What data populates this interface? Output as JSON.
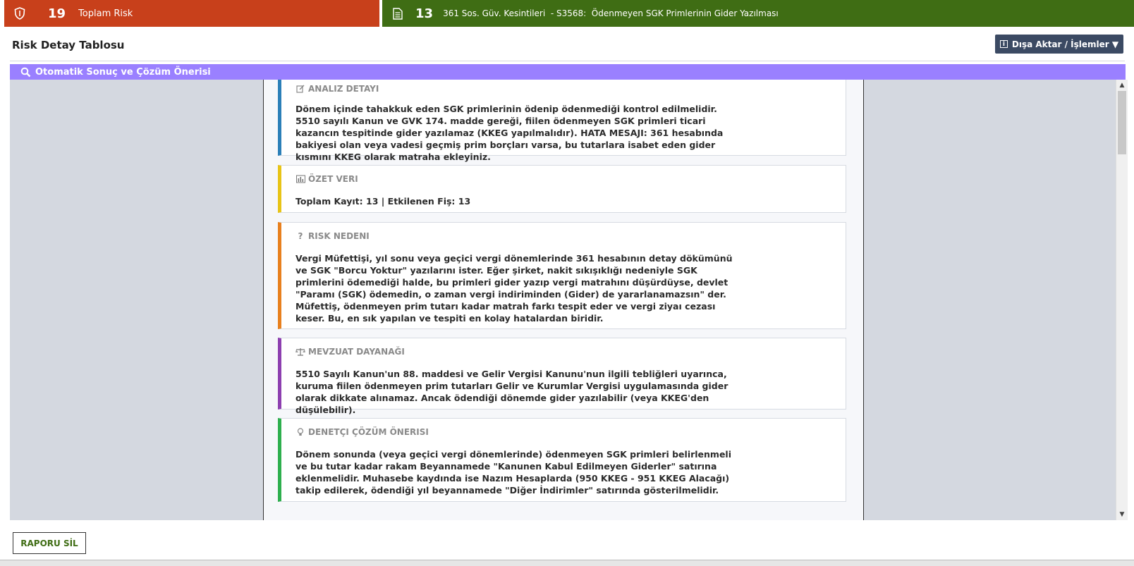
{
  "top": {
    "risk_count": "19",
    "risk_label": "Toplam Risk",
    "item_count": "13",
    "item_label": "361 Sos. Güv. Kesintileri  - S3568:  Ödenmeyen SGK Primlerinin Gider Yazılması"
  },
  "header": {
    "title": "Risk Detay Tablosu",
    "export_label": "Dışa Aktar / İşlemler ▼"
  },
  "section": {
    "title": "Otomatik Sonuç ve Çözüm Önerisi"
  },
  "cards": [
    {
      "title": "ANALIZ DETAYI",
      "icon": "note-icon",
      "color": "#2b7fb8",
      "text": "Dönem içinde tahakkuk eden SGK primlerinin ödenip ödenmediği kontrol edilmelidir. 5510 sayılı Kanun ve GVK 174. madde gereği, fiilen ödenmeyen SGK primleri ticari kazancın tespitinde gider yazılamaz (KKEG yapılmalıdır). HATA MESAJI: 361 hesabında bakiyesi olan veya vadesi geçmiş prim borçları varsa, bu tutarlara isabet eden gider kısmını KKEG olarak matraha ekleyiniz."
    },
    {
      "title": "ÖZET VERI",
      "icon": "chart-icon",
      "color": "#e8c417",
      "text": "Toplam Kayıt: 13 | Etkilenen Fiş: 13"
    },
    {
      "title": "RISK NEDENI",
      "icon": "question-icon",
      "color": "#e8801e",
      "text": "Vergi Müfettişi, yıl sonu veya geçici vergi dönemlerinde 361 hesabının detay dökümünü ve SGK \"Borcu Yoktur\" yazılarını ister. Eğer şirket, nakit sıkışıklığı nedeniyle SGK primlerini ödemediği halde, bu primleri gider yazıp vergi matrahını düşürdüyse, devlet \"Paramı (SGK) ödemedin, o zaman vergi indiriminden (Gider) de yararlanamazsın\" der. Müfettiş, ödenmeyen prim tutarı kadar matrah farkı tespit eder ve vergi ziyaı cezası keser. Bu, en sık yapılan ve tespiti en kolay hatalardan biridir."
    },
    {
      "title": "MEVZUAT DAYANAĞI",
      "icon": "scale-icon",
      "color": "#8d3fb0",
      "text": "5510 Sayılı Kanun'un 88. maddesi ve Gelir Vergisi Kanunu'nun ilgili tebliğleri uyarınca, kuruma fiilen ödenmeyen prim tutarları Gelir ve Kurumlar Vergisi uygulamasında gider olarak dikkate alınamaz. Ancak ödendiği dönemde gider yazılabilir (veya KKEG'den düşülebilir)."
    },
    {
      "title": "DENETÇI ÇÖZÜM ÖNERISI",
      "icon": "lightbulb-icon",
      "color": "#2eaf4e",
      "text": "Dönem sonunda (veya geçici vergi dönemlerinde) ödenmeyen SGK primleri belirlenmeli ve bu tutar kadar rakam Beyannamede \"Kanunen Kabul Edilmeyen Giderler\" satırına eklenmelidir. Muhasebe kaydında ise Nazım Hesaplarda (950 KKEG - 951 KKEG Alacağı) takip edilerek, ödendiği yıl beyannamede \"Diğer İndirimler\" satırında gösterilmelidir."
    }
  ],
  "footer": {
    "delete_label": "RAPORU SİL"
  }
}
